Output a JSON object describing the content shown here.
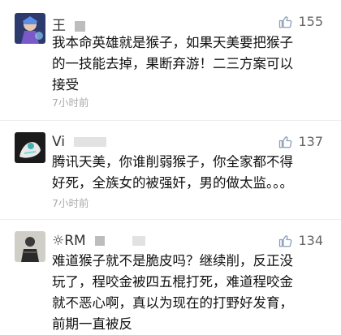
{
  "comments": [
    {
      "username": "王",
      "likes": "155",
      "text_lines": [
        "我本命英雄就是猴子，如果天美要把猴子",
        "的一技能去掉，果断弃游！二三方案可以",
        "接受"
      ],
      "time": "7小时前",
      "avatar_icon": "anime-hero-avatar"
    },
    {
      "username": "Vi",
      "likes": "137",
      "text_lines": [
        "腾讯天美，你谁削弱猴子，你全家都不得",
        "好死，全族女的被强奸，男的做太监。。。"
      ],
      "time": "7小时前",
      "avatar_icon": "anime-character-avatar"
    },
    {
      "username": "☼RM",
      "likes": "134",
      "text_lines": [
        "难道猴子就不是脆皮吗？继续削，反正没",
        "玩了，程咬金被四五棍打死，难道程咬金",
        "就不恶心啊，真以为现在的打野好发育，",
        "前期一直被反"
      ],
      "avatar_icon": "person-photo-avatar"
    }
  ],
  "colors": {
    "text": "#111111",
    "meta": "#aaaaaa",
    "likes": "#666666"
  }
}
